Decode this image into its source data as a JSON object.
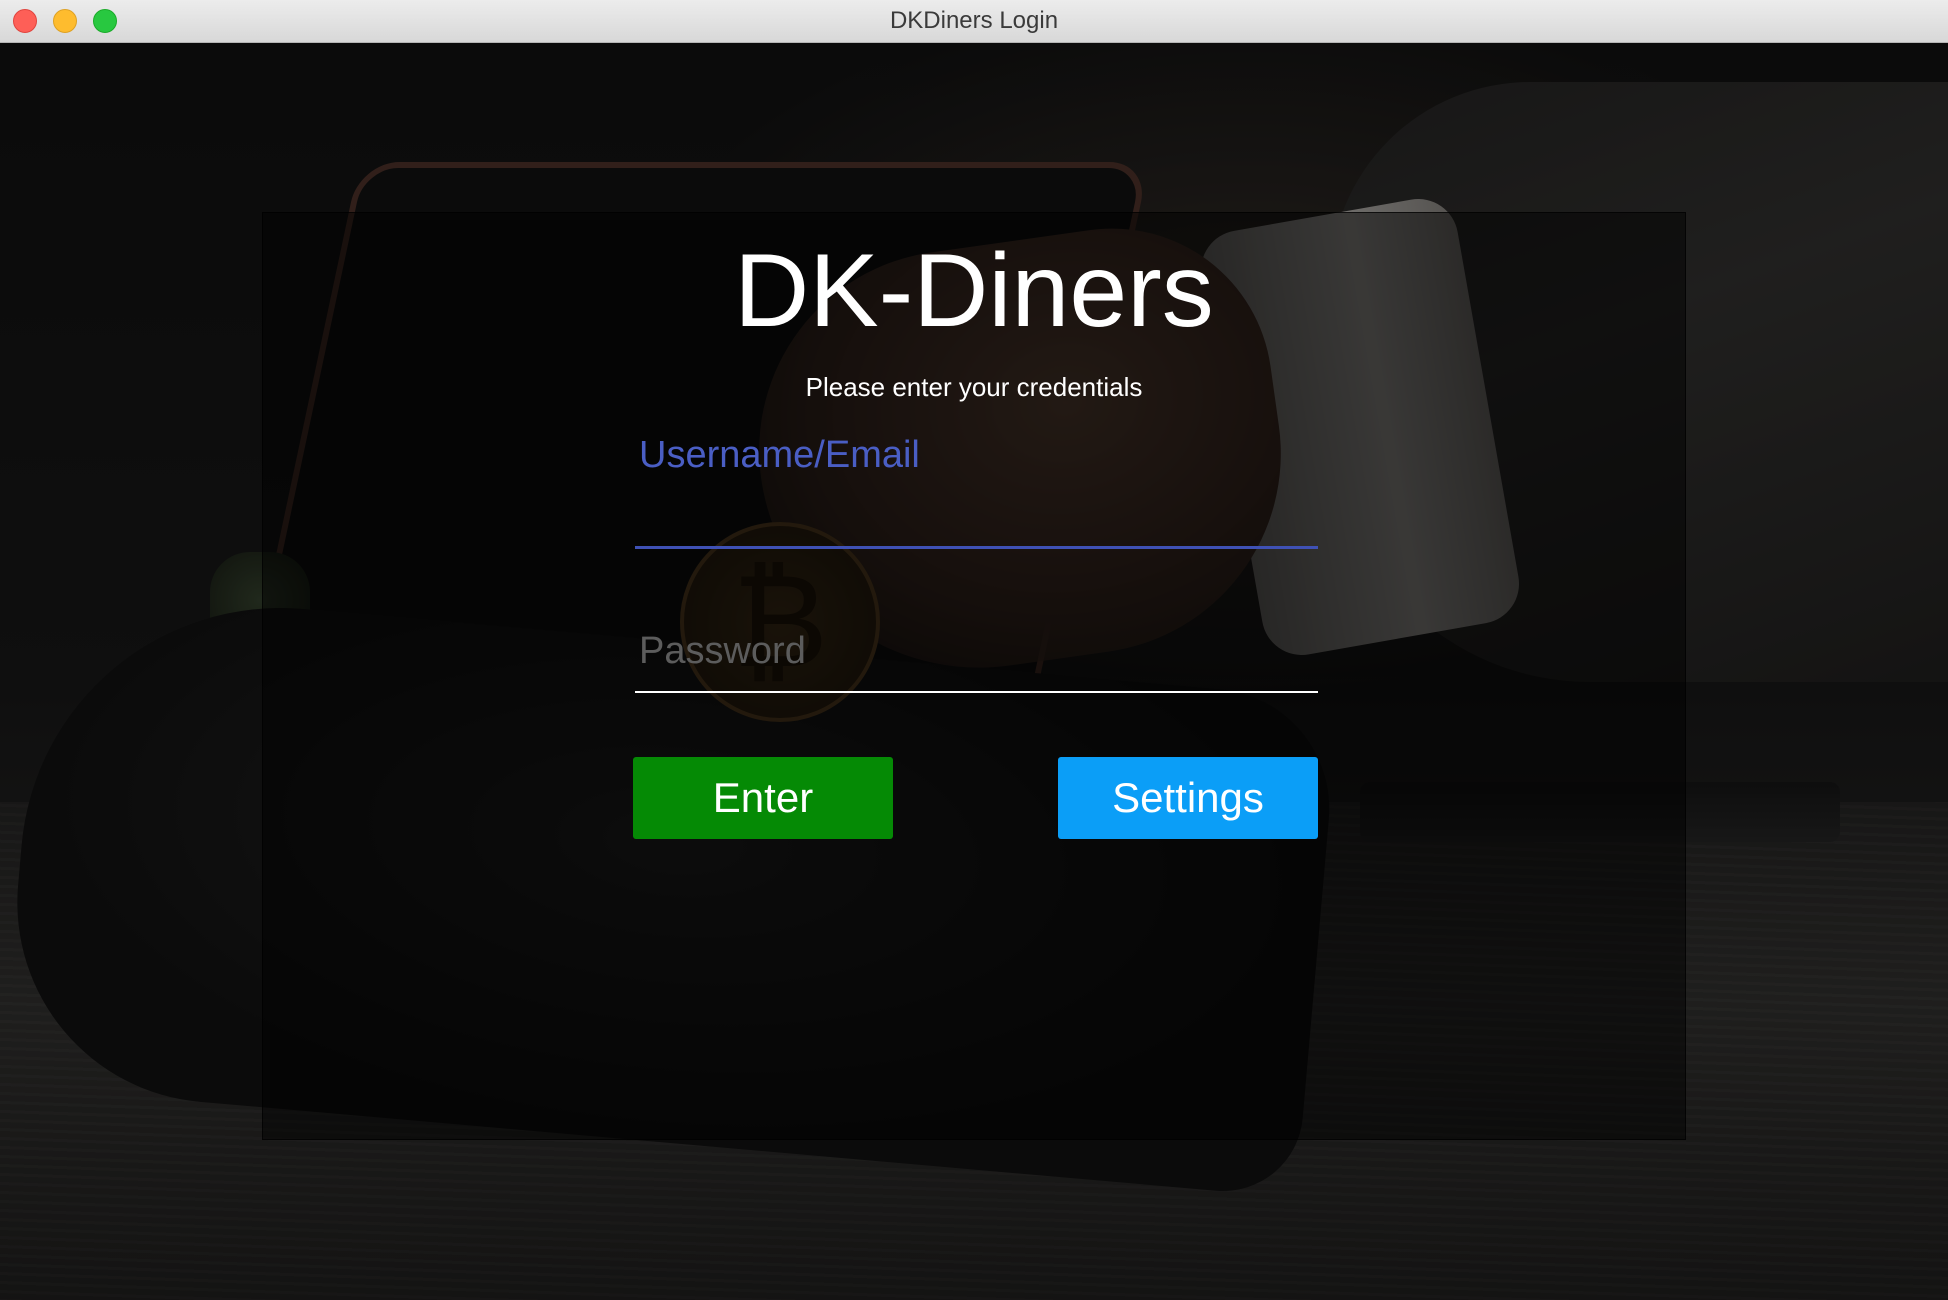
{
  "window": {
    "title": "DKDiners Login"
  },
  "login": {
    "brand": "DK-Diners",
    "subtitle": "Please enter your credentials",
    "username": {
      "label": "Username/Email",
      "value": ""
    },
    "password": {
      "label": "Password",
      "value": ""
    },
    "enter_label": "Enter",
    "settings_label": "Settings"
  },
  "colors": {
    "enter_button": "#058a05",
    "settings_button": "#0b9ef7",
    "username_accent": "#3f51b5",
    "password_label": "#5c5c5c"
  },
  "icons": {
    "close": "close-icon",
    "minimize": "minimize-icon",
    "zoom": "zoom-icon"
  }
}
